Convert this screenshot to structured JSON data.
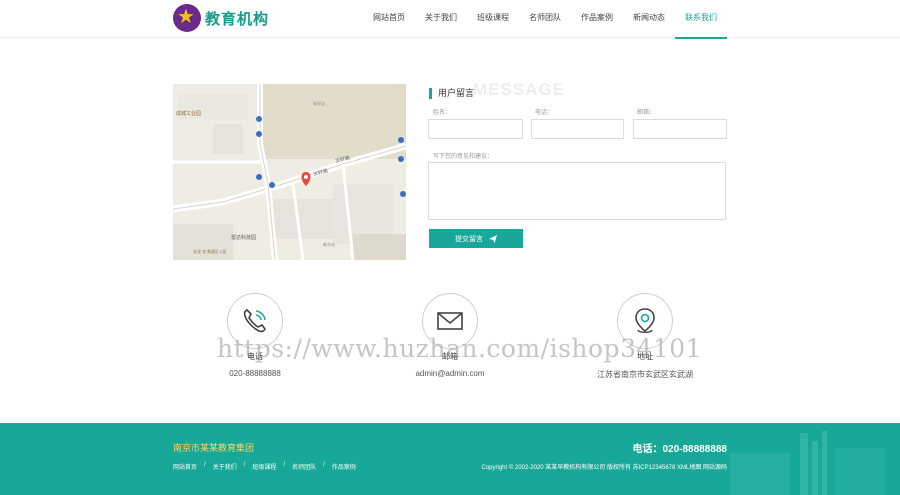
{
  "header": {
    "logo_text": "教育机构",
    "nav": [
      {
        "label": "网站首页"
      },
      {
        "label": "关于我们"
      },
      {
        "label": "班级课程"
      },
      {
        "label": "名师团队"
      },
      {
        "label": "作品案例"
      },
      {
        "label": "新闻动态"
      },
      {
        "label": "联系我们",
        "active": true
      }
    ]
  },
  "map": {
    "labels": [
      "成城工业园",
      "安好店",
      "文轩路",
      "文轩路",
      "雷达科技园",
      "文化·艺术园区·C区",
      "新车站"
    ]
  },
  "form": {
    "title": "用户留言",
    "title_bg": "MESSAGE",
    "name_label": "姓名：",
    "phone_label": "电话：",
    "email_label": "邮箱：",
    "message_label": "写下您的意见和建议：",
    "name_value": "",
    "phone_value": "",
    "email_value": "",
    "message_value": "",
    "submit_label": "提交留言"
  },
  "contacts": [
    {
      "label": "电话",
      "value": "020-88888888",
      "icon": "phone-icon"
    },
    {
      "label": "邮箱",
      "value": "admin@admin.com",
      "icon": "mail-icon"
    },
    {
      "label": "地址",
      "value": "江苏省南京市玄武区玄武湖",
      "icon": "location-icon"
    }
  ],
  "watermark": "https://www.huzhan.com/ishop34101",
  "footer": {
    "company": "南京市某某教育集团",
    "phone": "电话：020-88888888",
    "links": [
      "网站首页",
      "关于我们",
      "班级课程",
      "名师团队",
      "作品案例"
    ],
    "copyright": "Copyright © 2002-2020 某某早教机构有限公司 版权所有  苏ICP12345678  XML地图  网站源码"
  },
  "colors": {
    "accent": "#18a89a",
    "footer_bg": "#18a898",
    "footer_company": "#f5d46a"
  }
}
